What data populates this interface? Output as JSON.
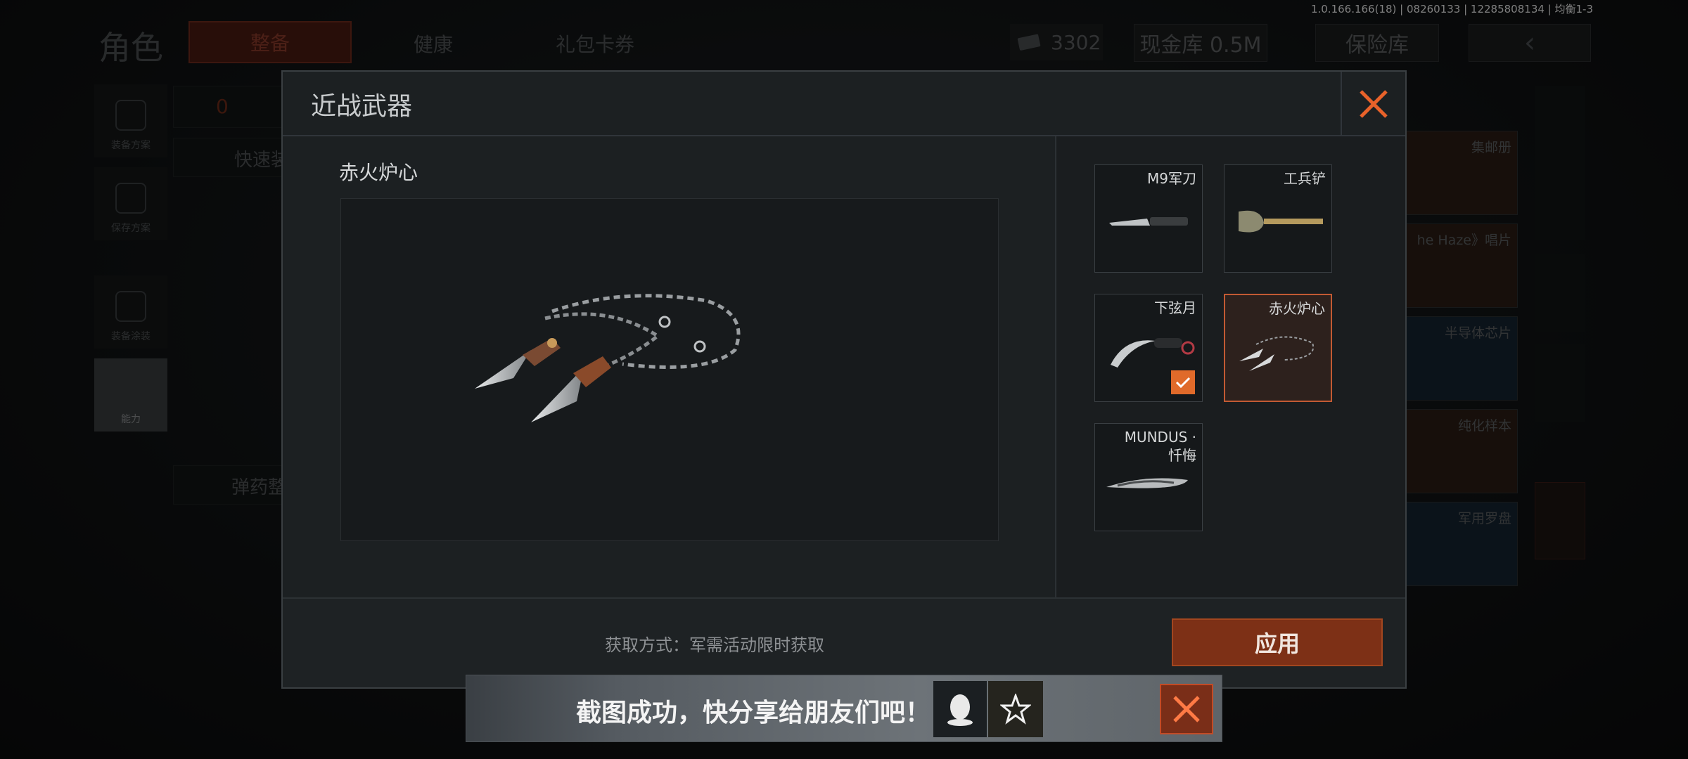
{
  "version": "1.0.166.166(18) | 08260133 | 12285808134 | 均衡1-3",
  "topbar": {
    "role_label": "角色",
    "tabs": {
      "equip": "整备",
      "health": "健康",
      "gift": "礼包卡券"
    },
    "currency_value": "3302",
    "cash_vault": "现金库 0.5M",
    "safe_box": "保险库"
  },
  "sidebar": {
    "items": [
      {
        "label": "装备方案"
      },
      {
        "label": "保存方案"
      },
      {
        "label": "装备涂装"
      },
      {
        "label": "能力"
      }
    ]
  },
  "bg_left": {
    "fast_equip": "快速装",
    "ammo": "弹药整",
    "zero": "0"
  },
  "bg_items": [
    {
      "label": "集邮册"
    },
    {
      "label": "he Haze》唱片"
    },
    {
      "label": "半导体芯片"
    },
    {
      "label": "纯化样本"
    },
    {
      "label": "军用罗盘"
    }
  ],
  "modal": {
    "title": "近战武器",
    "selected_name": "赤火炉心",
    "weapons": [
      {
        "name": "M9军刀"
      },
      {
        "name": "工兵铲"
      },
      {
        "name": "下弦月",
        "equipped": true
      },
      {
        "name": "赤火炉心",
        "selected": true
      },
      {
        "name": "MUNDUS ·",
        "name2": "忏悔"
      }
    ],
    "acquire": "获取方式：军需活动限时获取",
    "apply_label": "应用"
  },
  "toast": {
    "text": "截图成功，快分享给朋友们吧！"
  },
  "colors": {
    "accent": "#e06a2a",
    "apply": "#7d3016"
  }
}
